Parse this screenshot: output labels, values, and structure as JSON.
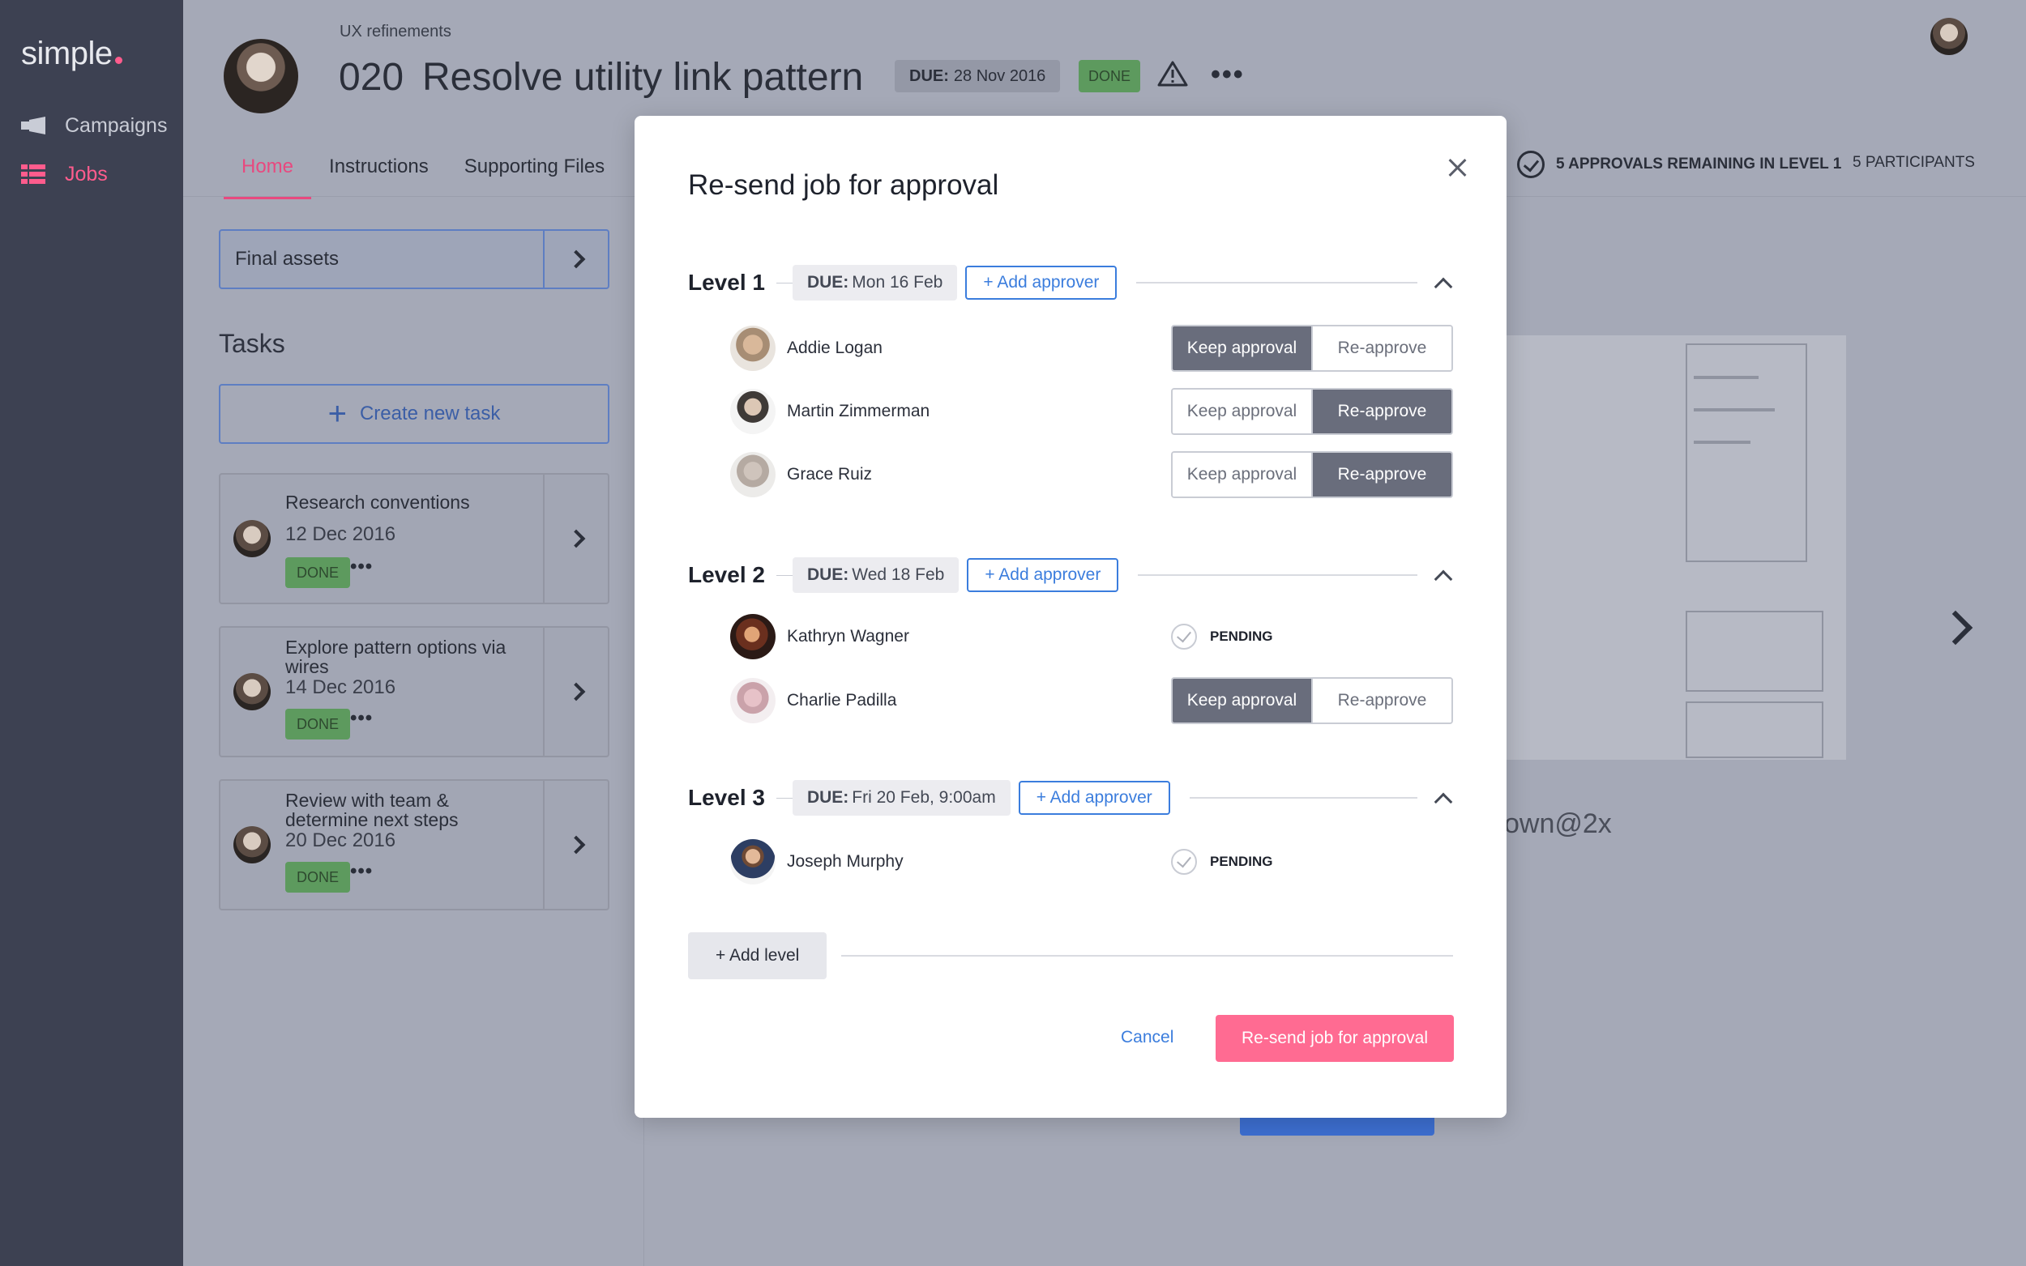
{
  "app": {
    "logo": "simple",
    "nav": [
      {
        "label": "Campaigns",
        "icon": "megaphone-icon"
      },
      {
        "label": "Jobs",
        "icon": "grid-icon",
        "active": true
      }
    ]
  },
  "job": {
    "breadcrumb": "UX refinements",
    "number": "020",
    "title": "Resolve utility link pattern",
    "due_label": "DUE:",
    "due_date": "28 Nov 2016",
    "status": "DONE",
    "more": "•••"
  },
  "tabs": [
    "Home",
    "Instructions",
    "Supporting Files"
  ],
  "approvals_remaining": "5 APPROVALS REMAINING IN LEVEL 1",
  "participants": "5 PARTICIPANTS",
  "left": {
    "final_assets": "Final assets",
    "tasks_heading": "Tasks",
    "create_task": "Create new task",
    "create_task_plus": "+",
    "tasks": [
      {
        "title": "Research conventions",
        "date": "12 Dec 2016",
        "status": "DONE",
        "more": "•••"
      },
      {
        "title": "Explore pattern options via wires",
        "date": "14 Dec 2016",
        "status": "DONE",
        "more": "•••"
      },
      {
        "title": "Review with team & determine next steps",
        "date": "20 Dec 2016",
        "status": "DONE",
        "more": "•••"
      }
    ]
  },
  "preview": {
    "caption": "own@2x"
  },
  "modal": {
    "title": "Re-send job for approval",
    "add_approver_label": "+ Add approver",
    "keep_label": "Keep approval",
    "reapprove_label": "Re-approve",
    "pending_label": "PENDING",
    "due_prefix": "DUE:",
    "levels": [
      {
        "label": "Level 1",
        "due": "Mon 16 Feb",
        "approvers": [
          {
            "name": "Addie Logan",
            "state": "keep"
          },
          {
            "name": "Martin Zimmerman",
            "state": "reapprove"
          },
          {
            "name": "Grace Ruiz",
            "state": "reapprove"
          }
        ]
      },
      {
        "label": "Level 2",
        "due": "Wed 18 Feb",
        "approvers": [
          {
            "name": "Kathryn Wagner",
            "state": "pending"
          },
          {
            "name": "Charlie Padilla",
            "state": "keep"
          }
        ]
      },
      {
        "label": "Level 3",
        "due": "Fri 20 Feb, 9:00am",
        "approvers": [
          {
            "name": "Joseph Murphy",
            "state": "pending"
          }
        ]
      }
    ],
    "add_level": "+ Add level",
    "cancel": "Cancel",
    "submit": "Re-send job for approval"
  },
  "colors": {
    "accent": "#ff5c8d",
    "primary_blue": "#3b7ddd",
    "done_green": "#5d9a5e",
    "toggle_on": "#696d7c",
    "submit_pink": "#ff6b92"
  }
}
